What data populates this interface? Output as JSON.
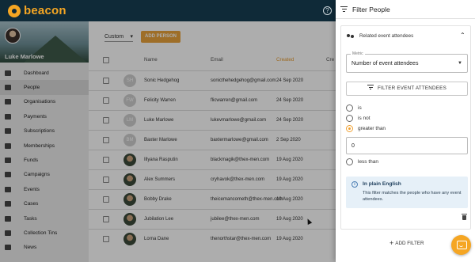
{
  "app": {
    "logo_text": "beacon",
    "help_symbol": "?"
  },
  "sidebar": {
    "user_name": "Luke Marlowe",
    "items": [
      {
        "label": "Dashboard",
        "icon": "home-icon"
      },
      {
        "label": "People",
        "icon": "people-icon",
        "active": true
      },
      {
        "label": "Organisations",
        "icon": "organisation-icon"
      },
      {
        "label": "Payments",
        "icon": "payment-icon"
      },
      {
        "label": "Subscriptions",
        "icon": "subscription-icon"
      },
      {
        "label": "Memberships",
        "icon": "membership-icon"
      },
      {
        "label": "Funds",
        "icon": "funds-icon"
      },
      {
        "label": "Campaigns",
        "icon": "campaign-icon"
      },
      {
        "label": "Events",
        "icon": "event-icon"
      },
      {
        "label": "Cases",
        "icon": "case-icon"
      },
      {
        "label": "Tasks",
        "icon": "task-icon"
      },
      {
        "label": "Collection Tins",
        "icon": "tin-icon"
      },
      {
        "label": "News",
        "icon": "news-icon"
      }
    ]
  },
  "list": {
    "view_select": "Custom",
    "add_button": "ADD PERSON",
    "columns": [
      "Name",
      "Email",
      "Created",
      "Cre"
    ],
    "rows": [
      {
        "initials": "SH",
        "name": "Sonic Hedgehog",
        "email": "sonicthehedgehog@gmail.com",
        "created": "24 Sep 2020",
        "photo": false
      },
      {
        "initials": "FW",
        "name": "Felicity Warren",
        "email": "flicwarren@gmail.com",
        "created": "24 Sep 2020",
        "photo": false
      },
      {
        "initials": "LM",
        "name": "Luke Marlowe",
        "email": "lukevmarlowe@gmail.com",
        "created": "24 Sep 2020",
        "photo": false
      },
      {
        "initials": "BM",
        "name": "Baxter Marlowe",
        "email": "baxtermarlowe@gmail.com",
        "created": "2 Sep 2020",
        "photo": false
      },
      {
        "initials": "",
        "name": "Illyana Rasputin",
        "email": "blackmagik@thex-men.com",
        "created": "19 Aug 2020",
        "photo": true
      },
      {
        "initials": "",
        "name": "Alex Summers",
        "email": "cryhavok@thex-men.com",
        "created": "19 Aug 2020",
        "photo": true
      },
      {
        "initials": "",
        "name": "Bobby Drake",
        "email": "theicemancometh@thex-men.com",
        "created": "19 Aug 2020",
        "photo": true
      },
      {
        "initials": "",
        "name": "Jubilation Lee",
        "email": "jubilee@thex-men.com",
        "created": "19 Aug 2020",
        "photo": true
      },
      {
        "initials": "",
        "name": "Lorna Dane",
        "email": "thenorthstar@thex-men.com",
        "created": "19 Aug 2020",
        "photo": true
      }
    ]
  },
  "filter_panel": {
    "title": "Filter People",
    "group_title": "Related event attendees",
    "metric_label": "Metric",
    "metric_value": "Number of event attendees",
    "filter_button": "FILTER EVENT ATTENDEES",
    "options": [
      {
        "label": "is",
        "selected": false
      },
      {
        "label": "is not",
        "selected": false
      },
      {
        "label": "greater than",
        "selected": true
      }
    ],
    "value": "0",
    "less_than_label": "less than",
    "plain_english_title": "In plain English",
    "plain_english_text": "This filter matches the people who have any event attendees.",
    "add_filter": "ADD FILTER"
  },
  "colors": {
    "accent": "#f5a623",
    "topbar": "#0f2a38"
  }
}
